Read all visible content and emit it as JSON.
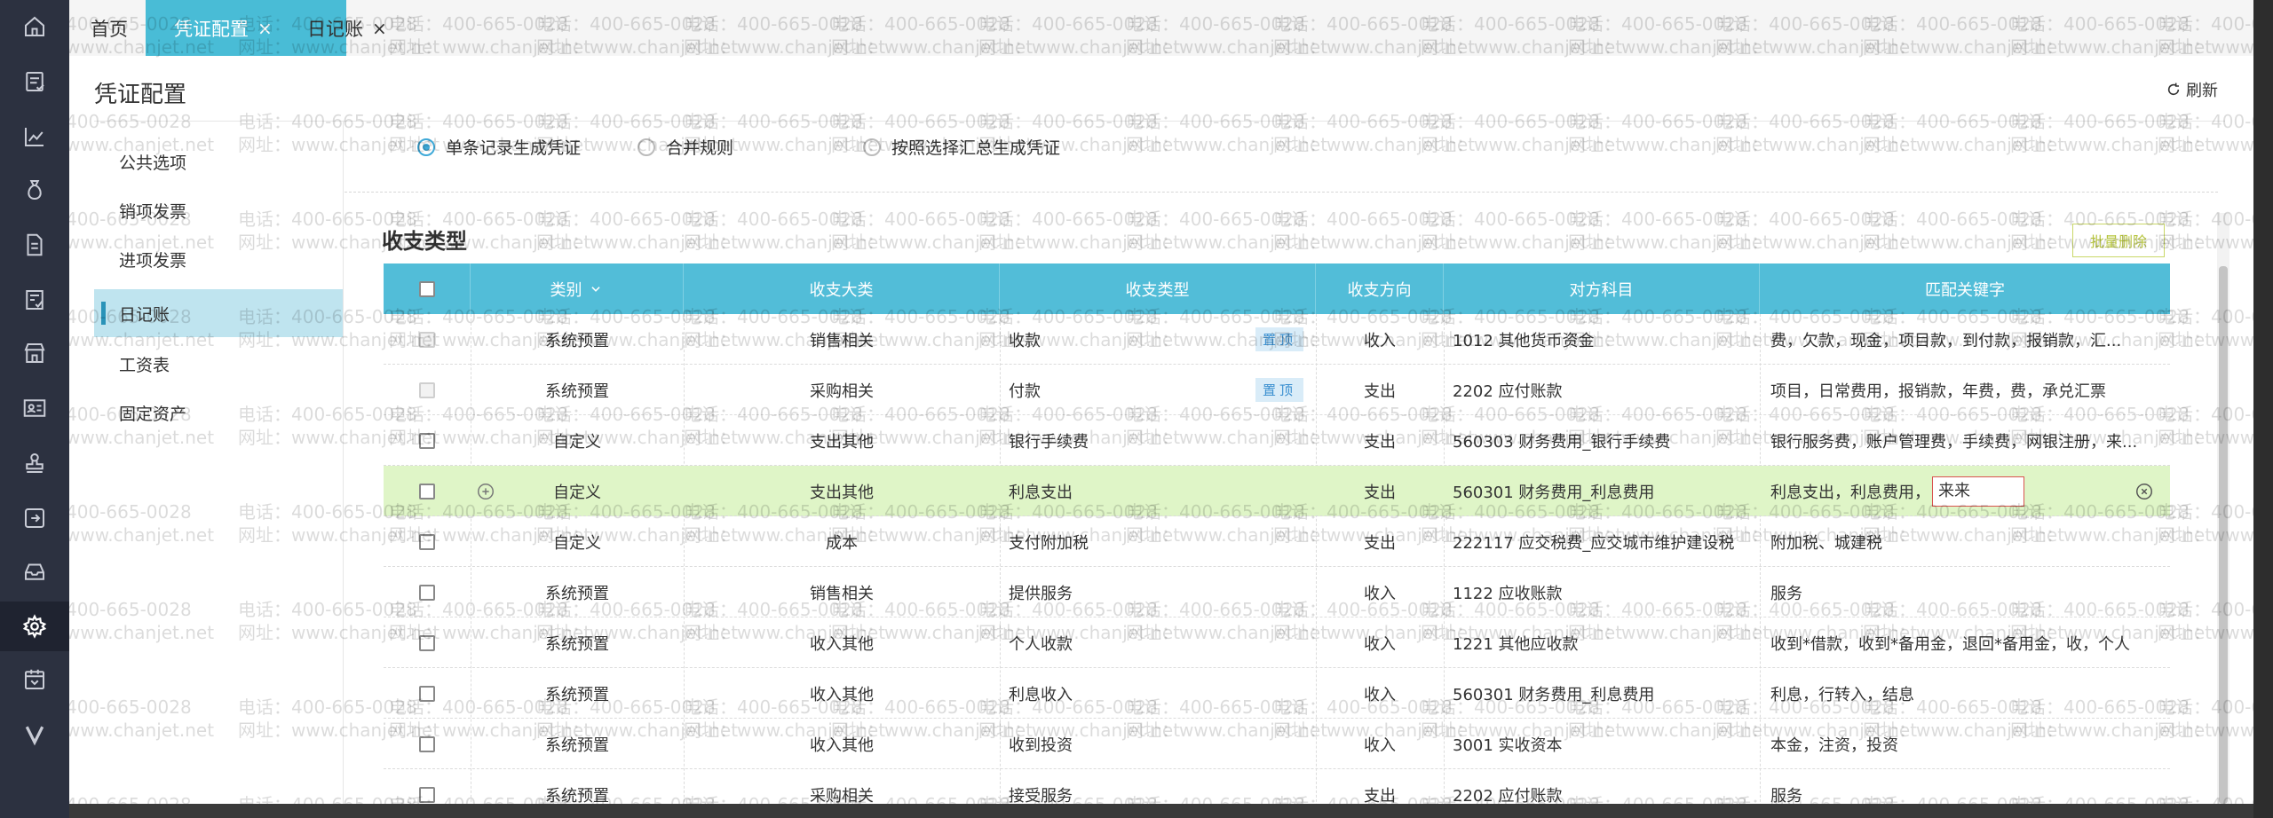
{
  "tabs": [
    {
      "label": "首页",
      "active": false,
      "closable": false
    },
    {
      "label": "凭证配置",
      "active": true,
      "closable": true
    },
    {
      "label": "日记账",
      "active": false,
      "closable": true
    }
  ],
  "tab_close_glyph": "×",
  "page_title": "凭证配置",
  "refresh_label": "刷新",
  "subnav": [
    "公共选项",
    "销项发票",
    "进项发票",
    "日记账",
    "工资表",
    "固定资产"
  ],
  "subnav_active": 3,
  "radios": [
    {
      "label": "单条记录生成凭证",
      "checked": true
    },
    {
      "label": "合并规则",
      "checked": false
    },
    {
      "label": "按照选择汇总生成凭证",
      "checked": false
    }
  ],
  "section_title": "收支类型",
  "batch_delete_label": "批量删除",
  "table": {
    "headers": [
      "",
      "类别",
      "收支大类",
      "收支类型",
      "收支方向",
      "对方科目",
      "匹配关键字"
    ],
    "pin_label": "置顶",
    "rows": [
      {
        "category": "系统预置",
        "major": "销售相关",
        "type": "收款",
        "direction": "收入",
        "account": "1012 其他货币资金",
        "keywords": "费，欠款，现金，项目款，到付款，报销款，汇...",
        "pin": true,
        "disabled": true
      },
      {
        "category": "系统预置",
        "major": "采购相关",
        "type": "付款",
        "direction": "支出",
        "account": "2202 应付账款",
        "keywords": "项目，日常费用，报销款，年费，费，承兑汇票",
        "pin": true,
        "disabled": true
      },
      {
        "category": "自定义",
        "major": "支出其他",
        "type": "银行手续费",
        "direction": "支出",
        "account": "560303 财务费用_银行手续费",
        "keywords": "银行服务费，账户管理费，手续费，网银注册，来...",
        "pin": false,
        "disabled": false
      },
      {
        "category": "自定义",
        "major": "支出其他",
        "type": "利息支出",
        "direction": "支出",
        "account": "560301 财务费用_利息费用",
        "keywords": "利息支出，利息费用，",
        "editing_value": "来来",
        "pin": false,
        "disabled": false,
        "highlight": true
      },
      {
        "category": "自定义",
        "major": "成本",
        "type": "支付附加税",
        "direction": "支出",
        "account": "222117 应交税费_应交城市维护建设税",
        "keywords": "附加税、城建税",
        "pin": false,
        "disabled": false
      },
      {
        "category": "系统预置",
        "major": "销售相关",
        "type": "提供服务",
        "direction": "收入",
        "account": "1122 应收账款",
        "keywords": "服务",
        "pin": false,
        "disabled": false
      },
      {
        "category": "系统预置",
        "major": "收入其他",
        "type": "个人收款",
        "direction": "收入",
        "account": "1221 其他应收款",
        "keywords": "收到*借款，收到*备用金，退回*备用金，收，个人",
        "pin": false,
        "disabled": false
      },
      {
        "category": "系统预置",
        "major": "收入其他",
        "type": "利息收入",
        "direction": "收入",
        "account": "560301 财务费用_利息费用",
        "keywords": "利息，行转入，结息",
        "pin": false,
        "disabled": false
      },
      {
        "category": "系统预置",
        "major": "收入其他",
        "type": "收到投资",
        "direction": "收入",
        "account": "3001 实收资本",
        "keywords": "本金，注资，投资",
        "pin": false,
        "disabled": false
      },
      {
        "category": "系统预置",
        "major": "采购相关",
        "type": "接受服务",
        "direction": "支出",
        "account": "2202 应付账款",
        "keywords": "服务",
        "pin": false,
        "disabled": false
      }
    ]
  },
  "watermark": {
    "phone": "电话：400-665-0028",
    "site": "网址：www.chanjet.net",
    "phone_short": "400-665-0028",
    "site_short": "www.chanjet.net"
  },
  "rail_icons": [
    "home-icon",
    "voucher-icon",
    "chart-icon",
    "money-bag-icon",
    "document-icon",
    "invoice-icon",
    "shop-icon",
    "id-card-icon",
    "stamp-icon",
    "export-icon",
    "inbox-icon",
    "settings-icon",
    "calendar-icon",
    "brand-v-icon"
  ],
  "colors": {
    "accent": "#49bcd6",
    "header": "#52bdd8",
    "highlight_row": "#dff5c7",
    "rail": "#2c3140"
  }
}
